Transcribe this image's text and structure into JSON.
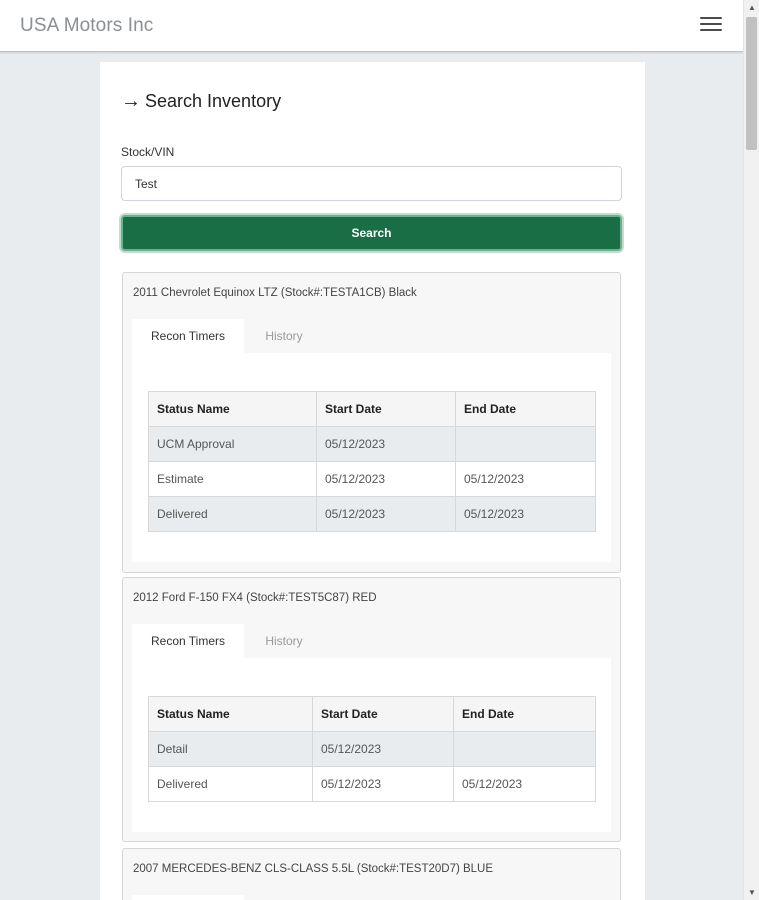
{
  "app": {
    "title": "USA Motors Inc"
  },
  "page": {
    "heading": "Search Inventory"
  },
  "search": {
    "label": "Stock/VIN",
    "value": "Test",
    "button_label": "Search"
  },
  "tabs": {
    "recon_timers": "Recon Timers",
    "history": "History"
  },
  "table_headers": {
    "status_name": "Status Name",
    "start_date": "Start Date",
    "end_date": "End Date"
  },
  "results": [
    {
      "title": "2011 Chevrolet Equinox LTZ (Stock#:TESTA1CB) Black",
      "rows": [
        {
          "status": "UCM Approval",
          "start": "05/12/2023",
          "end": ""
        },
        {
          "status": "Estimate",
          "start": "05/12/2023",
          "end": "05/12/2023"
        },
        {
          "status": "Delivered",
          "start": "05/12/2023",
          "end": "05/12/2023"
        }
      ]
    },
    {
      "title": "2012 Ford F-150 FX4 (Stock#:TEST5C87) RED",
      "rows": [
        {
          "status": "Detail",
          "start": "05/12/2023",
          "end": ""
        },
        {
          "status": "Delivered",
          "start": "05/12/2023",
          "end": "05/12/2023"
        }
      ]
    },
    {
      "title": "2007 MERCEDES-BENZ CLS-CLASS 5.5L (Stock#:TEST20D7) BLUE"
    }
  ]
}
